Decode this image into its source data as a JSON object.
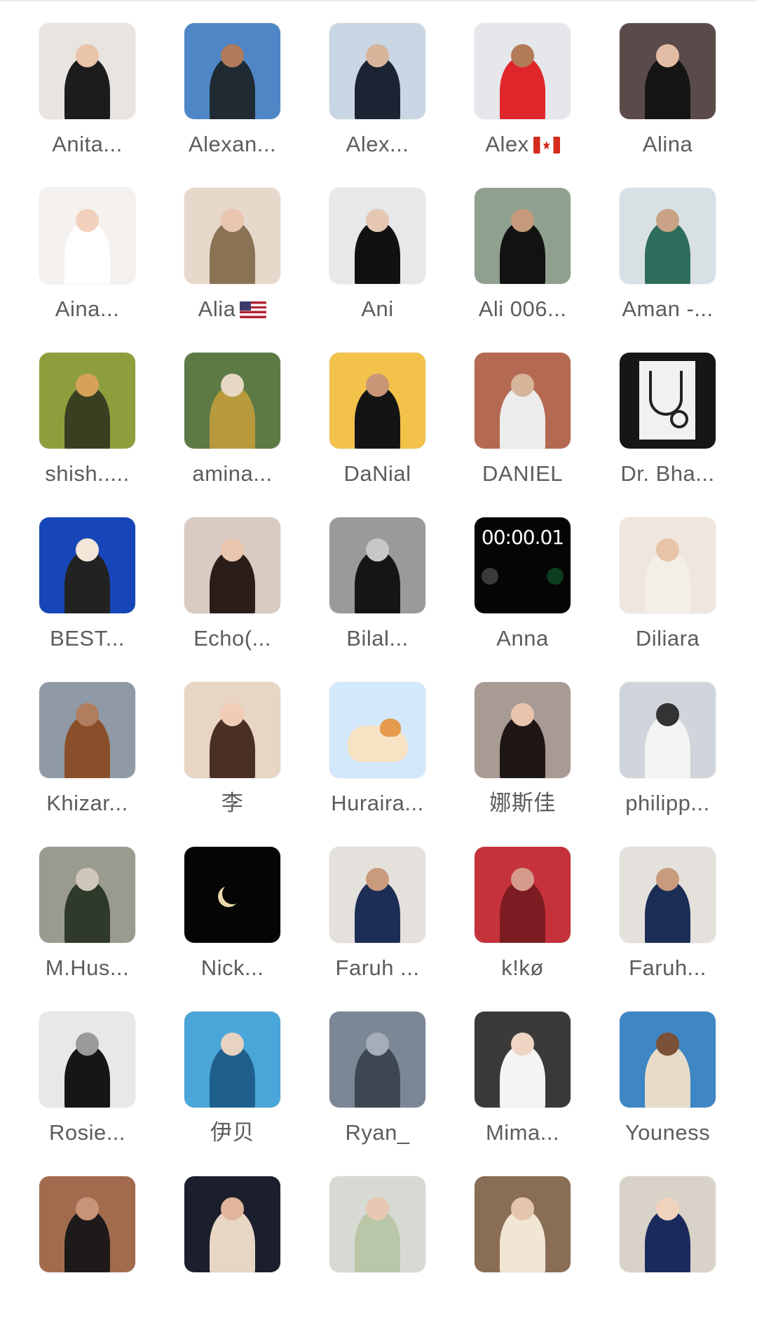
{
  "contacts": [
    {
      "name": "Anita...",
      "bg": "#e9e4df",
      "accent": "#1c1c1c",
      "skin": "#e8c4ab"
    },
    {
      "name": "Alexan...",
      "bg": "#4f87c6",
      "accent": "#1f2a33",
      "skin": "#b07c5c"
    },
    {
      "name": "Alex...",
      "bg": "#c9d6e3",
      "accent": "#1c2433",
      "skin": "#d8b49a"
    },
    {
      "name": "Alex",
      "flag": "ca",
      "bg": "#e5e7ea",
      "accent": "#e0262b",
      "skin": "#b47b58"
    },
    {
      "name": "Alina",
      "bg": "#5a4b4a",
      "accent": "#151515",
      "skin": "#e3bca5"
    },
    {
      "name": "Aina...",
      "bg": "#f5f1ee",
      "accent": "#ffffff",
      "skin": "#f1d1bd"
    },
    {
      "name": "Alia",
      "flag": "us",
      "bg": "#e7d8cc",
      "accent": "#8a7354",
      "skin": "#e9c6ae"
    },
    {
      "name": "Ani",
      "bg": "#e6e8ea",
      "accent": "#111111",
      "skin": "#e6c7b4"
    },
    {
      "name": "Ali 006...",
      "bg": "#8fa08f",
      "accent": "#121212",
      "skin": "#c59a7a"
    },
    {
      "name": "Aman -...",
      "bg": "#d8e0e4",
      "accent": "#2e6d5b",
      "skin": "#c9a184"
    },
    {
      "name": "shish.....",
      "bg": "#8d9f3c",
      "accent": "#3a3f22",
      "skin": "#d6a15b",
      "type": "dog"
    },
    {
      "name": "amina...",
      "bg": "#5d7a45",
      "accent": "#b89a3c",
      "skin": "#e6d8c2"
    },
    {
      "name": "DaNial",
      "bg": "#f2c24a",
      "accent": "#141414",
      "skin": "#c89676"
    },
    {
      "name": "DANIEL",
      "bg": "#b46a52",
      "accent": "#ececec",
      "skin": "#d7b59b"
    },
    {
      "name": "Dr. Bha...",
      "bg": "#161616",
      "accent": "#f1f1f1",
      "skin": "#222222",
      "type": "stetho"
    },
    {
      "name": "BEST...",
      "bg": "#1646b8",
      "accent": "#222222",
      "skin": "#f2e6d8"
    },
    {
      "name": "Echo(...",
      "bg": "#d9cbc2",
      "accent": "#2b1d18",
      "skin": "#e9c6ae"
    },
    {
      "name": "Bilal...",
      "bg": "#9a9a9a",
      "accent": "#151515",
      "skin": "#c7c7c7"
    },
    {
      "name": "Anna",
      "bg": "#050505",
      "accent": "#333333",
      "skin": "#333333",
      "type": "timer",
      "timer_text": "00:00.01"
    },
    {
      "name": "Diliara",
      "bg": "#efe7df",
      "accent": "#f4efe6",
      "skin": "#e8c3a7"
    },
    {
      "name": "Khizar...",
      "bg": "#8f9aa6",
      "accent": "#8a4f2a",
      "skin": "#b07d5e"
    },
    {
      "name": "李",
      "bg": "#e8d5c3",
      "accent": "#4a2f24",
      "skin": "#f1cbb4"
    },
    {
      "name": "Huraira...",
      "bg": "#d3e8fb",
      "accent": "#f0a04b",
      "skin": "#ffffff",
      "type": "dog2"
    },
    {
      "name": "娜斯佳",
      "bg": "#a89b94",
      "accent": "#1d1615",
      "skin": "#e9c5ae"
    },
    {
      "name": "philipp...",
      "bg": "#cfd5da",
      "accent": "#f4f4f4",
      "skin": "#333333"
    },
    {
      "name": "M.Hus...",
      "bg": "#9b9a8f",
      "accent": "#2f3a2a",
      "skin": "#d0c7bb"
    },
    {
      "name": "Nick...",
      "bg": "#050505",
      "accent": "#050505",
      "skin": "#050505",
      "type": "moon"
    },
    {
      "name": "Faruh ...",
      "bg": "#e4e1dc",
      "accent": "#1c2e55",
      "skin": "#c89b7d"
    },
    {
      "name": "k!kø",
      "bg": "#c5323b",
      "accent": "#7c1b21",
      "skin": "#d69a8b"
    },
    {
      "name": "Faruh...",
      "bg": "#e4e1dc",
      "accent": "#1c2e55",
      "skin": "#c89b7d"
    },
    {
      "name": "Rosie...",
      "bg": "#e8e8e8",
      "accent": "#161616",
      "skin": "#9a9a9a"
    },
    {
      "name": "伊贝",
      "bg": "#4aa6d8",
      "accent": "#1f5f8c",
      "skin": "#e8d2c0"
    },
    {
      "name": "Ryan_",
      "bg": "#7b8795",
      "accent": "#3d4752",
      "skin": "#a5aeb8"
    },
    {
      "name": "Mima...",
      "bg": "#3a3a3a",
      "accent": "#f5f5f5",
      "skin": "#efd5c4"
    },
    {
      "name": "Youness",
      "bg": "#3e86c4",
      "accent": "#e8dcc8",
      "skin": "#7b5137"
    },
    {
      "name": "",
      "bg": "#a36b4e",
      "accent": "#1e1a1a",
      "skin": "#c79478"
    },
    {
      "name": "",
      "bg": "#1a1f2b",
      "accent": "#e8d6c4",
      "skin": "#e0b59a"
    },
    {
      "name": "",
      "bg": "#d7dad3",
      "accent": "#b9c7a8",
      "skin": "#e7c8b2"
    },
    {
      "name": "",
      "bg": "#8a6d55",
      "accent": "#f1e6d4",
      "skin": "#e4c6ae"
    },
    {
      "name": "",
      "bg": "#d9d2c8",
      "accent": "#1b2a5c",
      "skin": "#f0d3bd"
    }
  ]
}
